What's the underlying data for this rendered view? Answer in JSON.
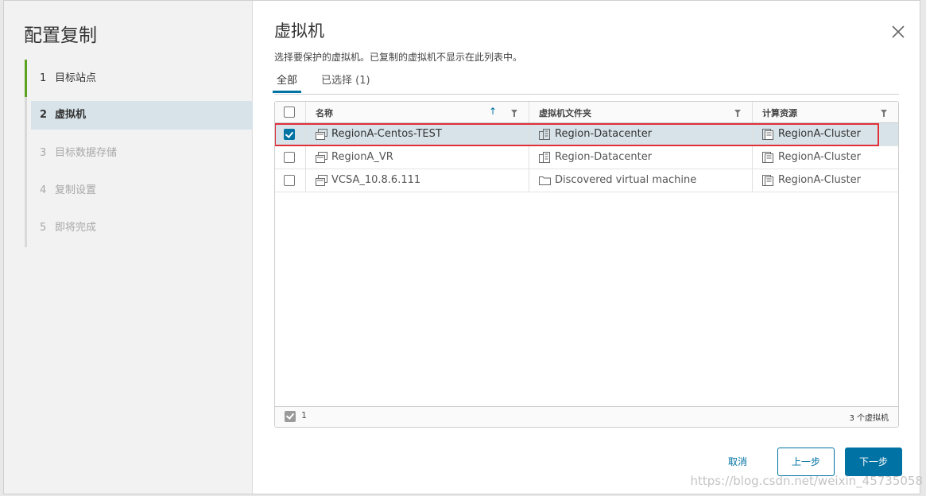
{
  "wizard": {
    "title": "配置复制",
    "steps": [
      {
        "num": "1",
        "label": "目标站点"
      },
      {
        "num": "2",
        "label": "虚拟机"
      },
      {
        "num": "3",
        "label": "目标数据存储"
      },
      {
        "num": "4",
        "label": "复制设置"
      },
      {
        "num": "5",
        "label": "即将完成"
      }
    ]
  },
  "page": {
    "title": "虚拟机",
    "subtitle": "选择要保护的虚拟机。已复制的虚拟机不显示在此列表中。",
    "tabs": [
      {
        "label": "全部"
      },
      {
        "label": "已选择 (1)"
      }
    ]
  },
  "grid": {
    "columns": {
      "name": "名称",
      "folder": "虚拟机文件夹",
      "resource": "计算资源"
    },
    "sort_icon": "arrow-up-icon",
    "rows": [
      {
        "name": "RegionA-Centos-TEST",
        "folder": "Region-Datacenter",
        "folder_icon": "datacenter-icon",
        "resource": "RegionA-Cluster",
        "checked": true
      },
      {
        "name": "RegionA_VR",
        "folder": "Region-Datacenter",
        "folder_icon": "datacenter-icon",
        "resource": "RegionA-Cluster",
        "checked": false
      },
      {
        "name": "VCSA_10.8.6.111",
        "folder": "Discovered virtual machine",
        "folder_icon": "folder-icon",
        "resource": "RegionA-Cluster",
        "checked": false
      }
    ],
    "footer": {
      "selected_count": "1",
      "total": "3 个虚拟机"
    }
  },
  "buttons": {
    "cancel": "取消",
    "back": "上一步",
    "next": "下一步"
  },
  "watermark": "https://blog.csdn.net/weixin_45735058",
  "colors": {
    "accent": "#0072a3",
    "done_step": "#5aa220",
    "highlight": "#e0303a",
    "selected_row": "#d8e3e9"
  }
}
